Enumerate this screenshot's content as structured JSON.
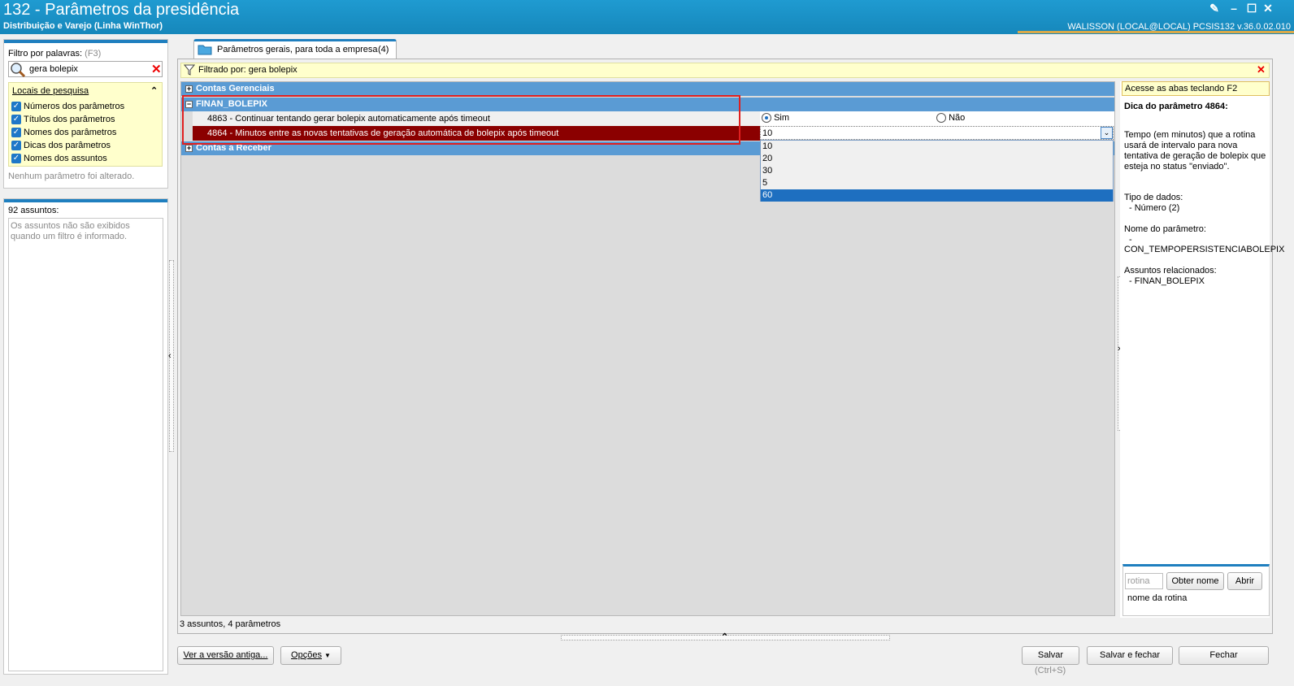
{
  "window": {
    "title": "132 - Parâmetros da presidência",
    "subtitle": "Distribuição e Varejo (Linha WinThor)",
    "user_info": "WALISSON (LOCAL@LOCAL)   PCSIS132  v.36.0.02.010"
  },
  "filter_panel": {
    "label": "Filtro por palavras:",
    "shortcut": "(F3)",
    "search_value": "gera bolepix",
    "locations_title": "Locais de pesquisa",
    "locations": [
      "Números dos parâmetros",
      "Títulos dos parâmetros",
      "Nomes dos parâmetros",
      "Dicas dos parâmetros",
      "Nomes dos assuntos"
    ],
    "status": "Nenhum parâmetro foi alterado."
  },
  "subjects_panel": {
    "count_label": "92 assuntos:",
    "message": "Os assuntos não são exibidos quando um filtro é informado."
  },
  "tab": {
    "label": "Parâmetros gerais, para toda a empresa",
    "count": "(4)"
  },
  "filter_bar": {
    "text": "Filtrado por: gera bolepix"
  },
  "grid": {
    "groups": [
      {
        "label": "Contas Gerenciais",
        "expander": "+"
      },
      {
        "label": "FINAN_BOLEPIX",
        "expander": "−"
      },
      {
        "label": "Contas a Receber",
        "expander": "+"
      }
    ],
    "params": [
      {
        "label": "4863 - Continuar tentando gerar bolepix automaticamente após timeout"
      },
      {
        "label": "4864 - Minutos entre as novas tentativas de geração automática de bolepix após timeout"
      }
    ],
    "radio_yes": "Sim",
    "radio_no": "Não",
    "combo_value": "10",
    "combo_options": [
      "10",
      "20",
      "30",
      "5",
      "60"
    ],
    "combo_highlighted": "60"
  },
  "right_panel": {
    "hint": "Acesse as abas teclando F2",
    "heading": "Dica do parâmetro 4864:",
    "description": "Tempo (em minutos) que a rotina usará de intervalo para nova tentativa de geração de bolepix que esteja no status \"enviado\".",
    "data_type_label": "Tipo de dados:",
    "data_type_value": "- Número (2)",
    "param_name_label": "Nome do parâmetro:",
    "param_name_dash": "-",
    "param_name_value": "CON_TEMPOPERSISTENCIABOLEPIX",
    "related_label": "Assuntos relacionados:",
    "related_value": "- FINAN_BOLEPIX",
    "rotina_placeholder": "rotina",
    "obter_nome": "Obter nome",
    "abrir": "Abrir",
    "rotina_name": "nome da rotina"
  },
  "status": {
    "summary": "3 assuntos, 4 parâmetros"
  },
  "footer": {
    "old_version": "Ver a versão antiga...",
    "options": "Opções",
    "save": "Salvar",
    "save_shortcut": "(Ctrl+S)",
    "save_close": "Salvar e fechar",
    "close": "Fechar"
  },
  "colors": {
    "titlebar": "#1f9bd1",
    "group_header": "#5a9bd4",
    "selected_row": "#8b0000",
    "highlight_box": "#e02020",
    "list_selection": "#1e6fc0"
  }
}
